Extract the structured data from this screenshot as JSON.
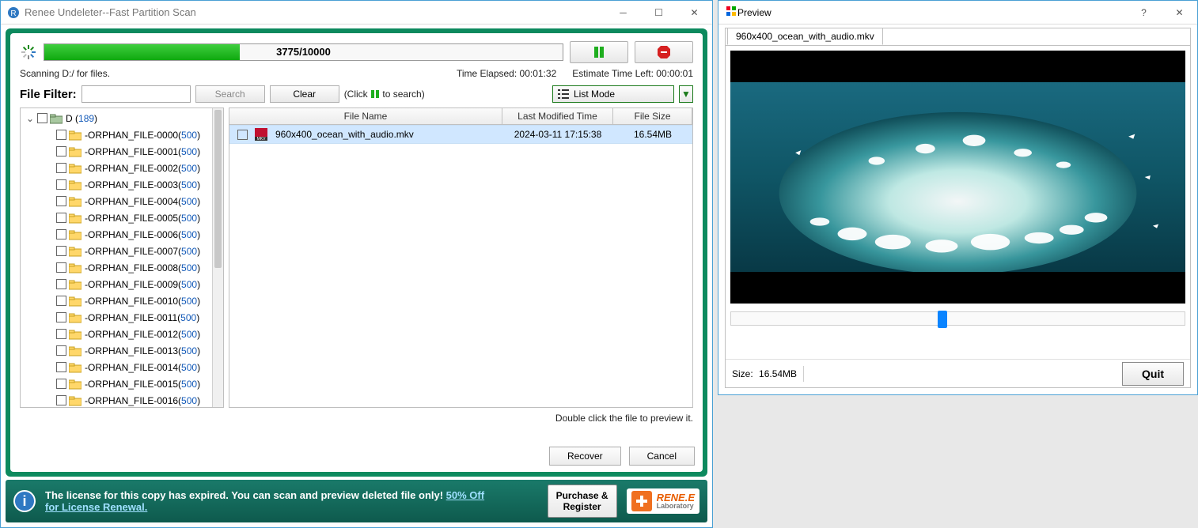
{
  "main": {
    "title": "Renee Undeleter--Fast Partition Scan",
    "progress_text": "3775/10000",
    "progress_percent": 37.75,
    "scanning_text": "Scanning D:/ for files.",
    "time_elapsed_label": "Time Elapsed: 00:01:32",
    "estimate_label": "Estimate Time Left: 00:00:01",
    "filter_label": "File  Filter:",
    "filter_value": "",
    "search_btn": "Search",
    "clear_btn": "Clear",
    "click_to_search_prefix": "(Click",
    "click_to_search_suffix": "to search)",
    "list_mode_btn": "List Mode",
    "columns": {
      "name": "File Name",
      "date": "Last Modified Time",
      "size": "File Size"
    },
    "preview_hint": "Double click the file to preview it.",
    "recover_btn": "Recover",
    "cancel_btn": "Cancel",
    "tree_root": {
      "drive": "D",
      "count": "189"
    },
    "tree_items": [
      {
        "name": "-ORPHAN_FILE-0000",
        "count": "500"
      },
      {
        "name": "-ORPHAN_FILE-0001",
        "count": "500"
      },
      {
        "name": "-ORPHAN_FILE-0002",
        "count": "500"
      },
      {
        "name": "-ORPHAN_FILE-0003",
        "count": "500"
      },
      {
        "name": "-ORPHAN_FILE-0004",
        "count": "500"
      },
      {
        "name": "-ORPHAN_FILE-0005",
        "count": "500"
      },
      {
        "name": "-ORPHAN_FILE-0006",
        "count": "500"
      },
      {
        "name": "-ORPHAN_FILE-0007",
        "count": "500"
      },
      {
        "name": "-ORPHAN_FILE-0008",
        "count": "500"
      },
      {
        "name": "-ORPHAN_FILE-0009",
        "count": "500"
      },
      {
        "name": "-ORPHAN_FILE-0010",
        "count": "500"
      },
      {
        "name": "-ORPHAN_FILE-0011",
        "count": "500"
      },
      {
        "name": "-ORPHAN_FILE-0012",
        "count": "500"
      },
      {
        "name": "-ORPHAN_FILE-0013",
        "count": "500"
      },
      {
        "name": "-ORPHAN_FILE-0014",
        "count": "500"
      },
      {
        "name": "-ORPHAN_FILE-0015",
        "count": "500"
      },
      {
        "name": "-ORPHAN_FILE-0016",
        "count": "500"
      }
    ],
    "file_rows": [
      {
        "name": "960x400_ocean_with_audio.mkv",
        "date": "2024-03-11 17:15:38",
        "size": "16.54MB"
      }
    ]
  },
  "footer": {
    "text1": "The license for this copy has expired. You can scan and preview deleted file only! ",
    "link1": "50% Off",
    "text2": "for License Renewal.",
    "purchase_btn": "Purchase & Register",
    "logo_main": "RENE.E",
    "logo_sub": "Laboratory"
  },
  "preview": {
    "title": "Preview",
    "tab": "960x400_ocean_with_audio.mkv",
    "size_label": "Size:",
    "size_value": "16.54MB",
    "quit_btn": "Quit",
    "slider_percent": 45.5
  }
}
